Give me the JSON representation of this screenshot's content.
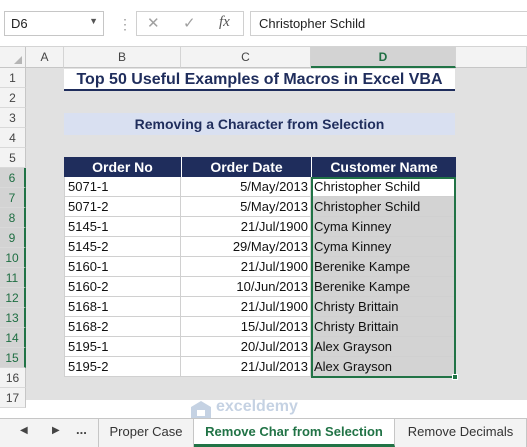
{
  "formula_bar": {
    "name_box": "D6",
    "formula_value": "Christopher Schild"
  },
  "columns": [
    "A",
    "B",
    "C",
    "D"
  ],
  "selected_column": "D",
  "rows": [
    "1",
    "2",
    "3",
    "4",
    "5",
    "6",
    "7",
    "8",
    "9",
    "10",
    "11",
    "12",
    "13",
    "14",
    "15",
    "16",
    "17"
  ],
  "sheet": {
    "title": "Top 50 Useful Examples of Macros in Excel VBA",
    "subtitle": "Removing a Character from Selection",
    "headers": [
      "Order No",
      "Order Date",
      "Customer Name"
    ],
    "table": [
      [
        "5071-1",
        "5/May/2013",
        "Christopher Schild"
      ],
      [
        "5071-2",
        "5/May/2013",
        "Christopher Schild"
      ],
      [
        "5145-1",
        "21/Jul/1900",
        "Cyma Kinney"
      ],
      [
        "5145-2",
        "29/May/2013",
        "Cyma Kinney"
      ],
      [
        "5160-1",
        "21/Jul/1900",
        "Berenike Kampe"
      ],
      [
        "5160-2",
        "10/Jun/2013",
        "Berenike Kampe"
      ],
      [
        "5168-1",
        "21/Jul/1900",
        "Christy Brittain"
      ],
      [
        "5168-2",
        "15/Jul/2013",
        "Christy Brittain"
      ],
      [
        "5195-1",
        "20/Jul/2013",
        "Alex Grayson"
      ],
      [
        "5195-2",
        "21/Jul/2013",
        "Alex Grayson"
      ]
    ]
  },
  "tabs": {
    "more": "...",
    "items": [
      "Proper Case",
      "Remove Char from Selection",
      "Remove Decimals"
    ],
    "active": "Remove Char from Selection"
  },
  "watermark": {
    "text": "exceldemy"
  },
  "colors": {
    "header_navy": "#1f2d5c",
    "subtitle_fill": "#d9e0f1",
    "excel_green": "#217346",
    "selection_gray": "#d3d3d3"
  }
}
